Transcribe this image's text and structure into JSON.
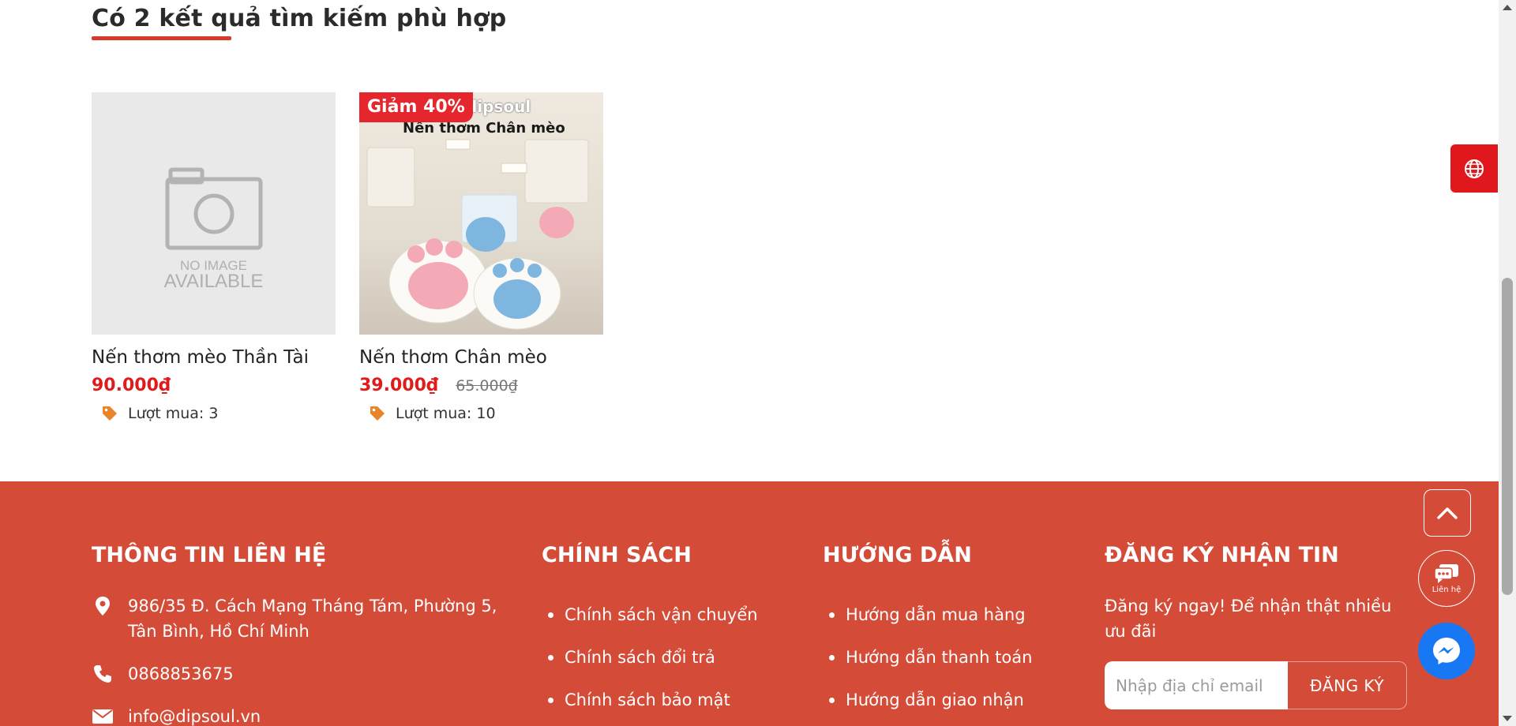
{
  "search": {
    "heading": "Có 2 kết quả tìm kiếm phù hợp"
  },
  "products": [
    {
      "name": "Nến thơm mèo Thần Tài",
      "price": "90.000₫",
      "sold": "Lượt mua: 3",
      "no_image_line1": "NO IMAGE",
      "no_image_line2": "AVAILABLE"
    },
    {
      "name": "Nến thơm Chân mèo",
      "price": "39.000₫",
      "old_price": "65.000₫",
      "discount": "Giảm 40%",
      "sold": "Lượt mua: 10",
      "photo_brand": "dipsoul",
      "photo_caption": "Nến thơm Chân mèo"
    }
  ],
  "footer": {
    "contact": {
      "title": "THÔNG TIN LIÊN HỆ",
      "address": "986/35 Đ. Cách Mạng Tháng Tám, Phường 5, Tân Bình, Hồ Chí Minh",
      "phone": "0868853675",
      "email": "info@dipsoul.vn"
    },
    "policy": {
      "title": "CHÍNH SÁCH",
      "items": [
        "Chính sách vận chuyển",
        "Chính sách đổi trả",
        "Chính sách bảo mật"
      ]
    },
    "guide": {
      "title": "HƯỚNG DẪN",
      "items": [
        "Hướng dẫn mua hàng",
        "Hướng dẫn thanh toán",
        "Hướng dẫn giao nhận"
      ]
    },
    "newsletter": {
      "title": "ĐĂNG KÝ NHẬN TIN",
      "description": "Đăng ký ngay! Để nhận thật nhiều ưu đãi",
      "placeholder": "Nhập địa chỉ email",
      "button": "ĐĂNG KÝ"
    }
  },
  "floating": {
    "contact_label": "Liên hệ"
  },
  "colors": {
    "accent": "#d44b38",
    "price": "#e01b1b",
    "badge": "#e5262d",
    "messenger": "#1877f2"
  }
}
